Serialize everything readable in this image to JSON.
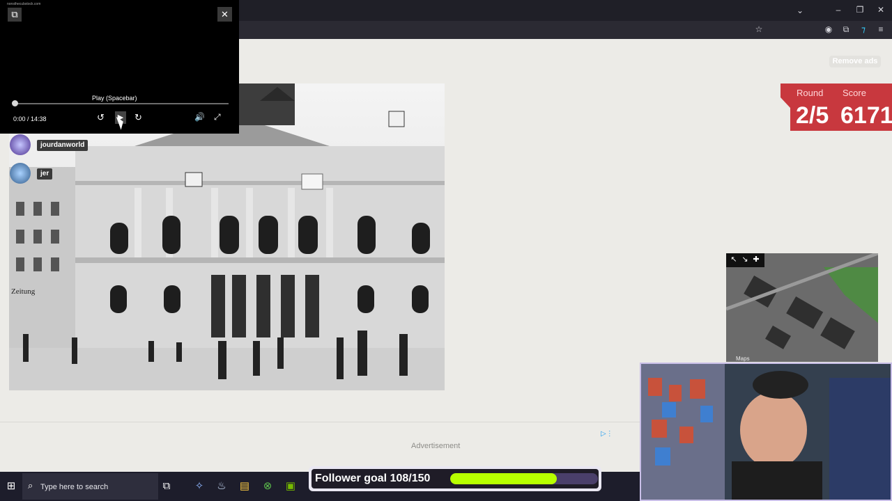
{
  "player": {
    "url": "nonsthecubstock.com",
    "play_tooltip": "Play (Spacebar)",
    "time_display": "0:00 / 14:38",
    "progress_fraction": 0.0
  },
  "players": [
    {
      "name": "jourdanworld"
    },
    {
      "name": "jer"
    }
  ],
  "page": {
    "remove_ads_label": "Remove ads",
    "round_label": "Round",
    "round_value": "2/5",
    "score_label": "Score",
    "score_value": "6171",
    "advertisement_label": "Advertisement"
  },
  "photo": {
    "sign_text": "Zeitung"
  },
  "minimap": {
    "tools": [
      "↖",
      "↘",
      "✚"
    ],
    "watermark": "Maps"
  },
  "taskbar": {
    "search_placeholder": "Type here to search"
  },
  "overlay": {
    "goal_text": "Follower goal 108/150",
    "goal_current": 108,
    "goal_target": 150
  },
  "colors": {
    "score_panel": "#c8383e",
    "goal_fill": "#b7ff00",
    "page_bg": "#ecebe7"
  }
}
